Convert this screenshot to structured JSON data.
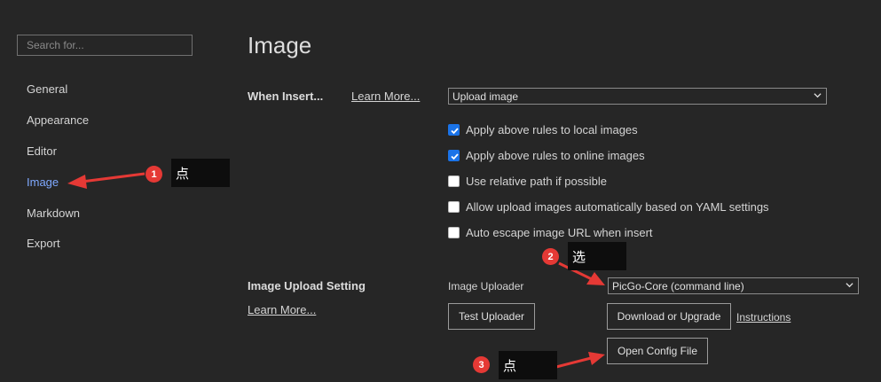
{
  "search": {
    "placeholder": "Search for..."
  },
  "sidebar": {
    "items": [
      {
        "label": "General"
      },
      {
        "label": "Appearance"
      },
      {
        "label": "Editor"
      },
      {
        "label": "Image",
        "active": true
      },
      {
        "label": "Markdown"
      },
      {
        "label": "Export"
      }
    ]
  },
  "page": {
    "title": "Image"
  },
  "when_insert": {
    "label": "When Insert...",
    "learn_more": "Learn More...",
    "selected": "Upload image",
    "options": [
      {
        "label": "Apply above rules to local images",
        "checked": true
      },
      {
        "label": "Apply above rules to online images",
        "checked": true
      },
      {
        "label": "Use relative path if possible",
        "checked": false
      },
      {
        "label": "Allow upload images automatically based on YAML settings",
        "checked": false
      },
      {
        "label": "Auto escape image URL when insert",
        "checked": false
      }
    ]
  },
  "upload_setting": {
    "label": "Image Upload Setting",
    "learn_more": "Learn More...",
    "uploader_label": "Image Uploader",
    "uploader_selected": "PicGo-Core (command line)",
    "test_button": "Test Uploader",
    "download_button": "Download or Upgrade",
    "instructions_link": "Instructions",
    "open_config_button": "Open Config File"
  },
  "annotations": [
    {
      "number": "1",
      "text": "点"
    },
    {
      "number": "2",
      "text": "选"
    },
    {
      "number": "3",
      "text": "点"
    }
  ],
  "colors": {
    "background": "#262626",
    "active_nav": "#7fa9ff",
    "checkbox_checked": "#1a73e8",
    "annotation_red": "#e53935",
    "annotation_note_bg": "#0d0d0d"
  }
}
